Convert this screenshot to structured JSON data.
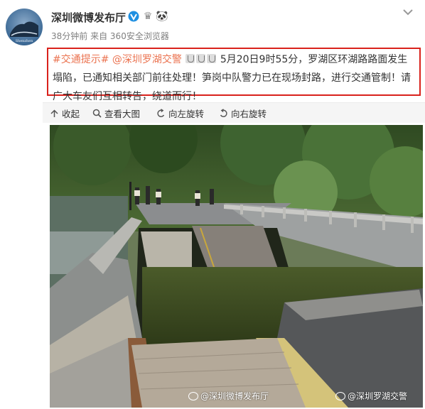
{
  "header": {
    "user_name": "深圳微博发布厅",
    "meta_time": "38分钟前",
    "meta_source": "来自 360安全浏览器"
  },
  "post": {
    "hashtag": "#交通提示#",
    "mention": "@深圳罗湖交警",
    "text_a": "5月20日9时55分，罗湖区环湖路路面发生塌陷，已通知相关部门前往处理！笋岗中队警力已在现场封路，进行交通管制！请广大车友们互相转告，绕道而行！"
  },
  "toolbar": {
    "collapse": "收起",
    "view_large": "查看大图",
    "rotate_left": "向左旋转",
    "rotate_right": "向右旋转"
  },
  "photo": {
    "watermark_left": "@深圳微博发布厅",
    "watermark_right": "@深圳罗湖交警"
  },
  "colors": {
    "highlight_border": "#d9221c",
    "link": "#eb7350",
    "vip_blue": "#1e8fe1"
  }
}
